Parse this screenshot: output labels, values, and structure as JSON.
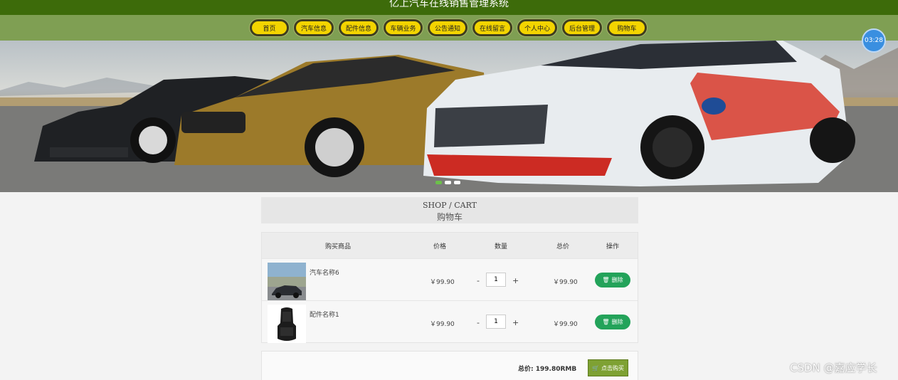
{
  "site": {
    "title": "亿上汽车在线销售管理系统"
  },
  "nav": [
    "首页",
    "汽车信息",
    "配件信息",
    "车辆业务",
    "公告通知",
    "在线留言",
    "个人中心",
    "后台管理",
    "购物车"
  ],
  "clock": "03:28",
  "banner": {
    "slides": 3,
    "active_slide": 1
  },
  "section": {
    "en": "SHOP / CART",
    "cn": "购物车"
  },
  "cart": {
    "headers": {
      "product": "购买商品",
      "price": "价格",
      "qty": "数量",
      "total": "总价",
      "action": "操作"
    },
    "items": [
      {
        "name": "汽车名称6",
        "price": "￥99.90",
        "qty": "1",
        "total": "￥99.90",
        "image": "car-thumbnail"
      },
      {
        "name": "配件名称1",
        "price": "￥99.90",
        "qty": "1",
        "total": "￥99.90",
        "image": "seat-thumbnail"
      }
    ],
    "minus": "-",
    "plus": "+",
    "delete_label": "删除"
  },
  "summary": {
    "total_label": "总价:  199.80RMB",
    "buy_label": "点击购买"
  },
  "watermark": "CSDN @嘉应学长",
  "colors": {
    "topbar": "#3d6b0a",
    "navbar": "#7f9f53",
    "nav_pill": "#f3d400",
    "delete_button": "#23a35a",
    "buy_button": "#7ea133",
    "clock": "#3a8fe0"
  }
}
